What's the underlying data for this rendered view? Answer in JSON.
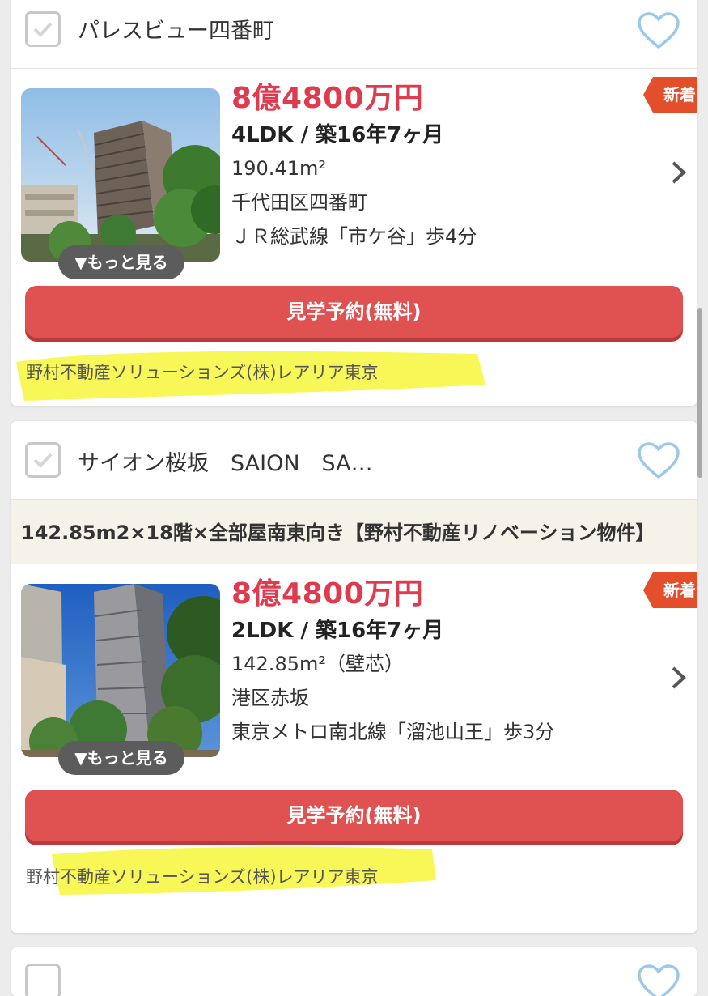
{
  "listings": [
    {
      "name": "パレスビュー四番町",
      "price": "8億4800万円",
      "layout": "4LDK / 築16年7ヶ月",
      "area": "190.41m²",
      "address": "千代田区四番町",
      "access": "ＪＲ総武線「市ケ谷」歩4分",
      "badge": "新着",
      "more_label": "▼もっと見る",
      "reserve_label": "見学予約(無料)",
      "agent": "野村不動産ソリューションズ(株)レアリア東京"
    },
    {
      "name": "サイオン桜坂　SAION　SA…",
      "promo": "142.85m2×18階×全部屋南東向き【野村不動産リノベーション物件】",
      "price": "8億4800万円",
      "layout": "2LDK / 築16年7ヶ月",
      "area": "142.85m²（壁芯）",
      "address": "港区赤坂",
      "access": "東京メトロ南北線「溜池山王」歩3分",
      "badge": "新着",
      "more_label": "▼もっと見る",
      "reserve_label": "見学予約(無料)",
      "agent": "野村不動産ソリューションズ(株)レアリア東京"
    }
  ],
  "colors": {
    "price": "#e03a4e",
    "button": "#e05252",
    "badge": "#e34e2b",
    "heart": "#9cc8ea",
    "highlight": "#f6f63a"
  }
}
